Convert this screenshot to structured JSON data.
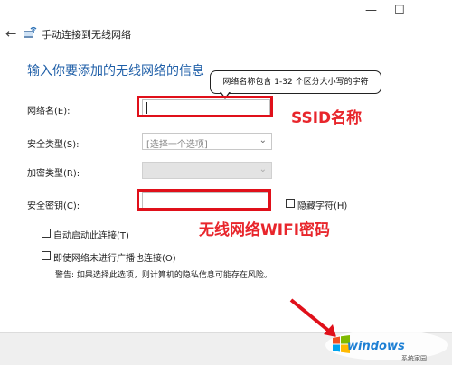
{
  "window": {
    "title": "手动连接到无线网络",
    "minimize": "—",
    "maximize": "☐",
    "back": "←"
  },
  "heading": "输入你要添加的无线网络的信息",
  "fields": {
    "network_name_label": "网络名(E):",
    "network_name_value": "",
    "security_type_label": "安全类型(S):",
    "security_type_value": "[选择一个选项]",
    "encryption_type_label": "加密类型(R):",
    "encryption_type_value": "",
    "security_key_label": "安全密钥(C):",
    "security_key_value": ""
  },
  "tooltip": "网络名称包含 1-32 个区分大小写的字符",
  "checkboxes": {
    "hide_chars": "隐藏字符(H)",
    "auto_start": "自动启动此连接(T)",
    "connect_hidden": "即使网络未进行广播也连接(O)"
  },
  "warning": "警告: 如果选择此选项，则计算机的隐私信息可能存在风险。",
  "annotations": {
    "ssid": "SSID名称",
    "password": "无线网络WIFI密码"
  },
  "watermark": {
    "brand": "windows",
    "sub": "系统家园"
  },
  "colors": {
    "heading": "#1f5fa8",
    "annotation_red": "#e0101a",
    "watermark_blue": "#1d7fd4"
  }
}
